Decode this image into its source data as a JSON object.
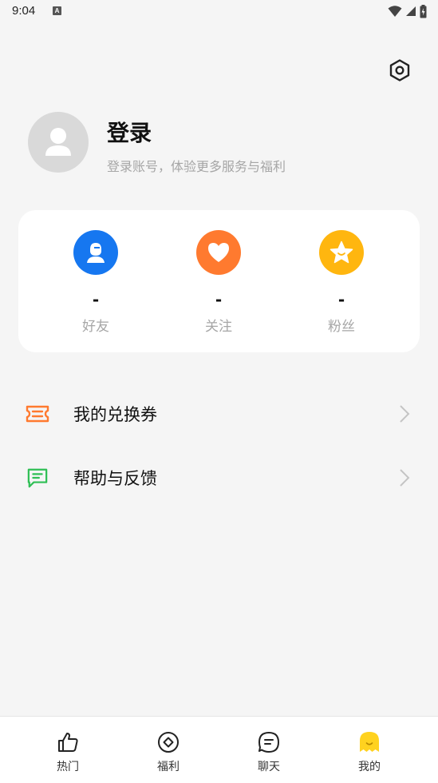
{
  "status_bar": {
    "time": "9:04",
    "notification_badge": "A"
  },
  "profile": {
    "title": "登录",
    "subtitle": "登录账号，体验更多服务与福利"
  },
  "stats": [
    {
      "icon": "friend-icon",
      "color": "#1677f0",
      "count": "-",
      "label": "好友"
    },
    {
      "icon": "heart-icon",
      "color": "#ff7a2f",
      "count": "-",
      "label": "关注"
    },
    {
      "icon": "star-icon",
      "color": "#ffb60f",
      "count": "-",
      "label": "粉丝"
    }
  ],
  "menu": [
    {
      "icon": "ticket-icon",
      "color": "#ff7a2f",
      "label": "我的兑换券"
    },
    {
      "icon": "message-icon",
      "color": "#2fbf55",
      "label": "帮助与反馈"
    }
  ],
  "bottom_nav": [
    {
      "icon": "thumb-up-icon",
      "label": "热门"
    },
    {
      "icon": "coin-icon",
      "label": "福利"
    },
    {
      "icon": "chat-icon",
      "label": "聊天"
    },
    {
      "icon": "ghost-icon",
      "label": "我的",
      "active": true,
      "color": "#ffd21f"
    }
  ]
}
